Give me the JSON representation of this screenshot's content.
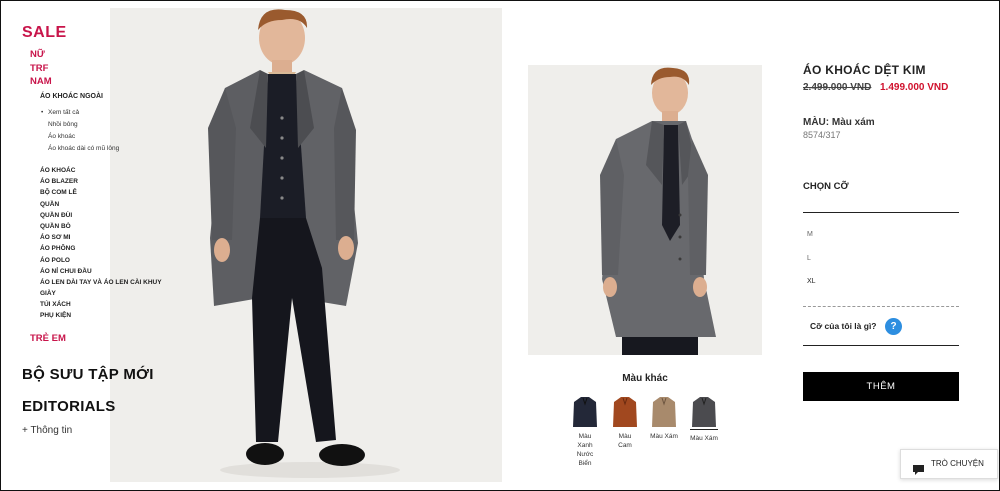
{
  "menu": {
    "sale": "SALE",
    "women": "NỮ",
    "trf": "TRF",
    "men": "NAM",
    "outerwear_heading": "ÁO KHOÁC NGOÀI",
    "outerwear_items": [
      "Xem tất cả",
      "Nhồi bông",
      "Áo khoác",
      "Áo khoác dài có mũ lông"
    ],
    "men_categories": [
      "ÁO KHOÁC",
      "ÁO BLAZER",
      "BỘ COM LÊ",
      "QUẦN",
      "QUẦN ĐÙI",
      "QUẦN BÒ",
      "ÁO SƠ MI",
      "ÁO PHÔNG",
      "ÁO POLO",
      "ÁO NỈ CHUI ĐẦU",
      "ÁO LEN DÀI TAY VÀ ÁO LEN CÀI KHUY",
      "GIÀY",
      "TÚI XÁCH",
      "PHỤ KIỆN"
    ],
    "kids": "TRẺ EM",
    "new_collection": "BỘ SƯU TẬP MỚI",
    "editorials": "EDITORIALS",
    "more_info": "+ Thông tin"
  },
  "product": {
    "title": "ÁO KHOÁC DỆT KIM",
    "old_price": "2.499.000 VND",
    "new_price": "1.499.000 VND",
    "color_label": "MÀU: Màu xám",
    "reference": "8574/317",
    "choose_size": "CHỌN CỠ",
    "sizes": [
      "M",
      "L",
      "XL"
    ],
    "size_guide": "Cỡ của tôi là gì?",
    "size_guide_icon": "?",
    "add_button": "THÊM"
  },
  "other_colors": {
    "title": "Màu khác",
    "swatches": [
      {
        "label": "Màu Xanh Nước Biển",
        "color": "#232838"
      },
      {
        "label": "Màu Cam",
        "color": "#a1481f"
      },
      {
        "label": "Màu Xám",
        "color": "#a88a6c"
      },
      {
        "label": "Màu Xám",
        "color": "#4b4b4f"
      }
    ]
  },
  "chat": {
    "label": "TRÒ CHUYỆN",
    "icon": "chat-bubble-icon"
  },
  "colors": {
    "sale_accent": "#c8144a",
    "price_red": "#d0102c",
    "help_blue": "#2d8ee0"
  }
}
